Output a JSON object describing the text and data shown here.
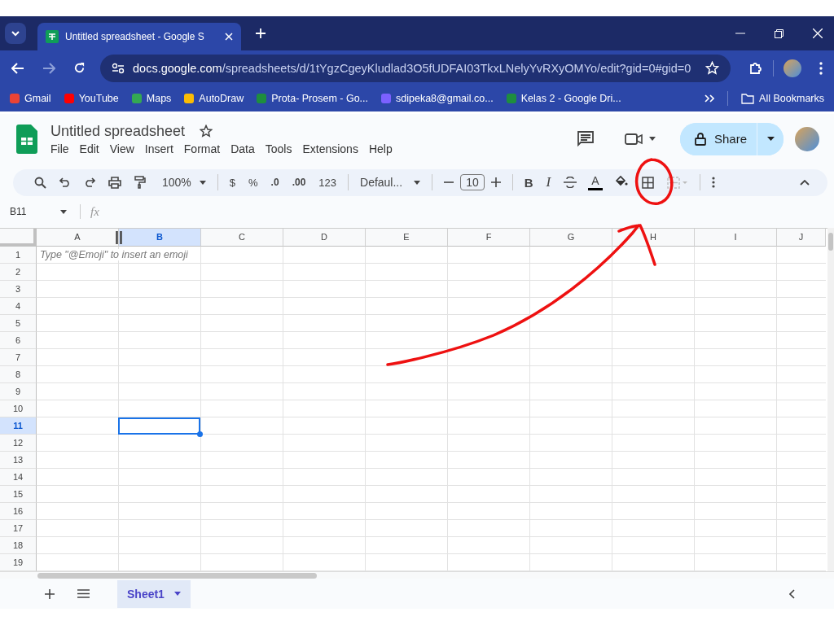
{
  "browser": {
    "tabs": [
      {
        "title": "Untitled spreadsheet - Google S",
        "selected": true
      }
    ],
    "address": {
      "domain": "docs.google.com",
      "path": "/spreadsheets/d/1tYgzCgeyKludlad3O5fUDFAI03TkxLNelyYvRXyOMYo/edit?gid=0#gid=0"
    },
    "bookmarks": [
      {
        "label": "Gmail",
        "color": "#ea4335"
      },
      {
        "label": "YouTube",
        "color": "#ff0000"
      },
      {
        "label": "Maps",
        "color": "#34a853"
      },
      {
        "label": "AutoDraw",
        "color": "#fbbc04"
      },
      {
        "label": "Prota- Prosem - Go...",
        "color": "#1e8e3e"
      },
      {
        "label": "sdipeka8@gmail.co...",
        "color": "#7b61ff"
      },
      {
        "label": "Kelas 2 - Google Dri...",
        "color": "#1e8e3e"
      }
    ],
    "all_bookmarks": "All Bookmarks"
  },
  "doc": {
    "title": "Untitled spreadsheet",
    "share": "Share"
  },
  "menu": [
    "File",
    "Edit",
    "View",
    "Insert",
    "Format",
    "Data",
    "Tools",
    "Extensions",
    "Help"
  ],
  "toolbar": {
    "zoom": "100%",
    "currency": "$",
    "percent": "%",
    "decrease_decimal": ".0",
    "increase_decimal": ".00",
    "number_format": "123",
    "font": "Defaul...",
    "font_size": "10",
    "bold": "B",
    "italic": "I",
    "text_color": "A"
  },
  "name_box": "B11",
  "formula_label": "fx",
  "columns": [
    {
      "label": "A",
      "selected": false
    },
    {
      "label": "B",
      "selected": true
    },
    {
      "label": "C",
      "selected": false
    },
    {
      "label": "D",
      "selected": false
    },
    {
      "label": "E",
      "selected": false
    },
    {
      "label": "F",
      "selected": false
    },
    {
      "label": "G",
      "selected": false
    },
    {
      "label": "H",
      "selected": false
    },
    {
      "label": "I",
      "selected": false
    },
    {
      "label": "J",
      "selected": false
    }
  ],
  "rows": [
    {
      "label": "1",
      "selected": false
    },
    {
      "label": "2",
      "selected": false
    },
    {
      "label": "3",
      "selected": false
    },
    {
      "label": "4",
      "selected": false
    },
    {
      "label": "5",
      "selected": false
    },
    {
      "label": "6",
      "selected": false
    },
    {
      "label": "7",
      "selected": false
    },
    {
      "label": "8",
      "selected": false
    },
    {
      "label": "9",
      "selected": false
    },
    {
      "label": "10",
      "selected": false
    },
    {
      "label": "11",
      "selected": true
    },
    {
      "label": "12",
      "selected": false
    },
    {
      "label": "13",
      "selected": false
    },
    {
      "label": "14",
      "selected": false
    },
    {
      "label": "15",
      "selected": false
    },
    {
      "label": "16",
      "selected": false
    },
    {
      "label": "17",
      "selected": false
    },
    {
      "label": "18",
      "selected": false
    },
    {
      "label": "19",
      "selected": false
    }
  ],
  "cell_hint": "Type \"@Emoji\" to insert an emoji",
  "sheets": [
    {
      "name": "Sheet1",
      "selected": true
    }
  ]
}
